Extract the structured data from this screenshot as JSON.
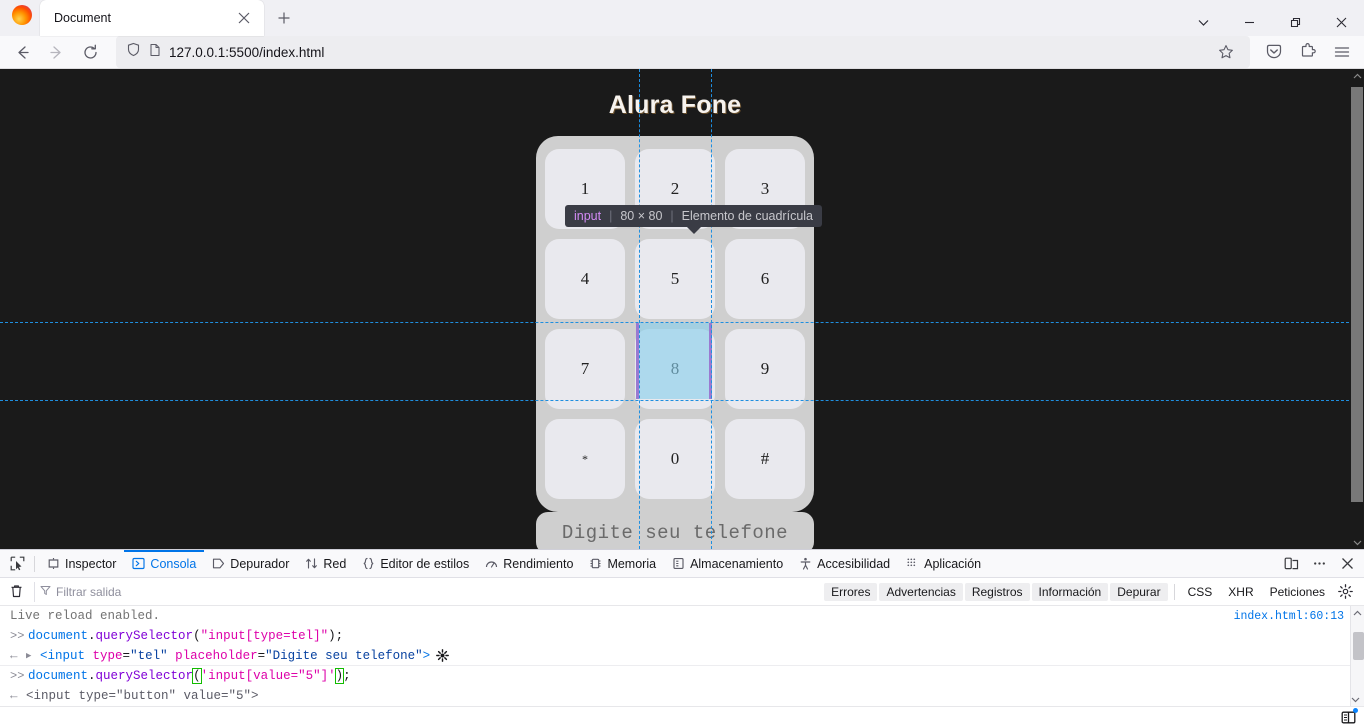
{
  "browser": {
    "tab": {
      "title": "Document",
      "close_icon": "close-icon",
      "favicon": "firefox-logo-icon"
    },
    "new_tab_label": "+",
    "window_controls": {
      "list_all_tabs": "chevron-down-icon",
      "minimize": "minimize-icon",
      "maximize": "maximize-icon",
      "close": "close-icon"
    },
    "nav": {
      "back": "back-arrow-icon",
      "forward": "forward-arrow-icon",
      "reload": "reload-icon",
      "shield": "shield-icon",
      "page": "page-icon",
      "url_scheme": "",
      "url": "127.0.0.1:5500/index.html",
      "bookmark": "star-icon",
      "pocket": "pocket-icon",
      "extensions": "extensions-icon",
      "menu": "hamburger-menu-icon"
    }
  },
  "page": {
    "title": "Alura Fone",
    "keys": [
      {
        "value": "1",
        "small": false
      },
      {
        "value": "2",
        "small": false
      },
      {
        "value": "3",
        "small": false
      },
      {
        "value": "4",
        "small": false
      },
      {
        "value": "5",
        "small": false
      },
      {
        "value": "6",
        "small": false
      },
      {
        "value": "7",
        "small": false
      },
      {
        "value": "8",
        "small": false
      },
      {
        "value": "9",
        "small": false
      },
      {
        "value": "*",
        "small": true
      },
      {
        "value": "0",
        "small": false
      },
      {
        "value": "#",
        "small": false
      }
    ],
    "phone_input_placeholder": "Digite seu telefone",
    "phone_input_value": "",
    "colors": {
      "background": "#1a1a1a",
      "phone_body": "#cfcfcf",
      "key": "#e9e9ee",
      "title": "#f7f3ee"
    }
  },
  "inspector_overlay": {
    "tooltip": {
      "tag": "input",
      "dimensions": "80 × 80",
      "layout_label": "Elemento de cuadrícula"
    },
    "highlight_color": "#87ceeb",
    "guide_color": "#1f8fe0"
  },
  "devtools": {
    "picker_icon": "element-picker-icon",
    "tabs": [
      {
        "label": "Inspector",
        "icon": "inspector-icon",
        "active": false
      },
      {
        "label": "Consola",
        "icon": "console-icon",
        "active": true
      },
      {
        "label": "Depurador",
        "icon": "debugger-icon",
        "active": false
      },
      {
        "label": "Red",
        "icon": "network-icon",
        "active": false
      },
      {
        "label": "Editor de estilos",
        "icon": "style-editor-icon",
        "active": false
      },
      {
        "label": "Rendimiento",
        "icon": "performance-icon",
        "active": false
      },
      {
        "label": "Memoria",
        "icon": "memory-icon",
        "active": false
      },
      {
        "label": "Almacenamiento",
        "icon": "storage-icon",
        "active": false
      },
      {
        "label": "Accesibilidad",
        "icon": "accessibility-icon",
        "active": false
      },
      {
        "label": "Aplicación",
        "icon": "application-icon",
        "active": false
      }
    ],
    "toolbar_right": {
      "responsive": "responsive-design-mode-icon",
      "meatball": "more-options-icon",
      "close": "close-devtools-icon"
    },
    "filterbar": {
      "clear": "trash-icon",
      "filter_icon": "filter-icon",
      "filter_placeholder": "Filtrar salida",
      "filter_value": "",
      "levels": [
        "Errores",
        "Advertencias",
        "Registros",
        "Información",
        "Depurar"
      ],
      "types": [
        "CSS",
        "XHR",
        "Peticiones"
      ],
      "settings": "gear-icon"
    },
    "console": {
      "rows": [
        {
          "kind": "log-cut",
          "text": "Live reload enabled.",
          "source": "index.html:60:13"
        },
        {
          "kind": "input",
          "prompt": ">>",
          "code": "document.querySelector(\"input[type=tel]\");"
        },
        {
          "kind": "output",
          "arrow": "←",
          "html": "<input type=\"tel\" placeholder=\"Digite seu telefone\">"
        },
        {
          "kind": "input",
          "prompt": ">>",
          "code": "document.querySelector('input[value=\"5\"]');"
        },
        {
          "kind": "output",
          "arrow": "←",
          "html": "<input type=\"button\" value=\"5\">"
        }
      ]
    },
    "statusbar": {
      "split_console": "split-console-icon"
    }
  }
}
